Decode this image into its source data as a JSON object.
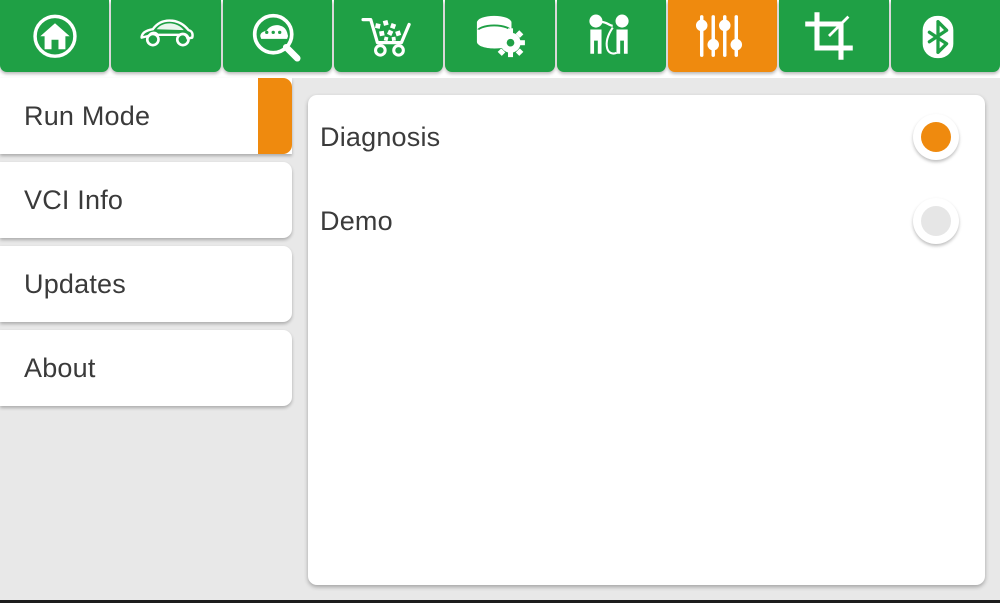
{
  "topbar": {
    "tabs": [
      {
        "id": "home",
        "icon": "home-icon",
        "active": false
      },
      {
        "id": "vehicle",
        "icon": "car-icon",
        "active": false
      },
      {
        "id": "diagnose",
        "icon": "car-search-icon",
        "active": false
      },
      {
        "id": "shop",
        "icon": "shopping-cart-icon",
        "active": false
      },
      {
        "id": "data",
        "icon": "database-gear-icon",
        "active": false
      },
      {
        "id": "support",
        "icon": "remote-support-icon",
        "active": false
      },
      {
        "id": "settings",
        "icon": "sliders-icon",
        "active": true
      },
      {
        "id": "screenshot",
        "icon": "crop-icon",
        "active": false
      },
      {
        "id": "bluetooth",
        "icon": "bluetooth-icon",
        "active": false
      }
    ]
  },
  "sidebar": {
    "items": [
      {
        "label": "Run Mode",
        "selected": true
      },
      {
        "label": "VCI Info",
        "selected": false
      },
      {
        "label": "Updates",
        "selected": false
      },
      {
        "label": "About",
        "selected": false
      }
    ]
  },
  "main": {
    "options": [
      {
        "label": "Diagnosis",
        "selected": true
      },
      {
        "label": "Demo",
        "selected": false
      }
    ]
  },
  "colors": {
    "tab_green": "#1fa045",
    "accent_orange": "#ef8a0e",
    "panel_white": "#ffffff",
    "background_gray": "#e8e8e8",
    "text_dark": "#3a3a3a",
    "radio_off": "#e6e6e6"
  }
}
